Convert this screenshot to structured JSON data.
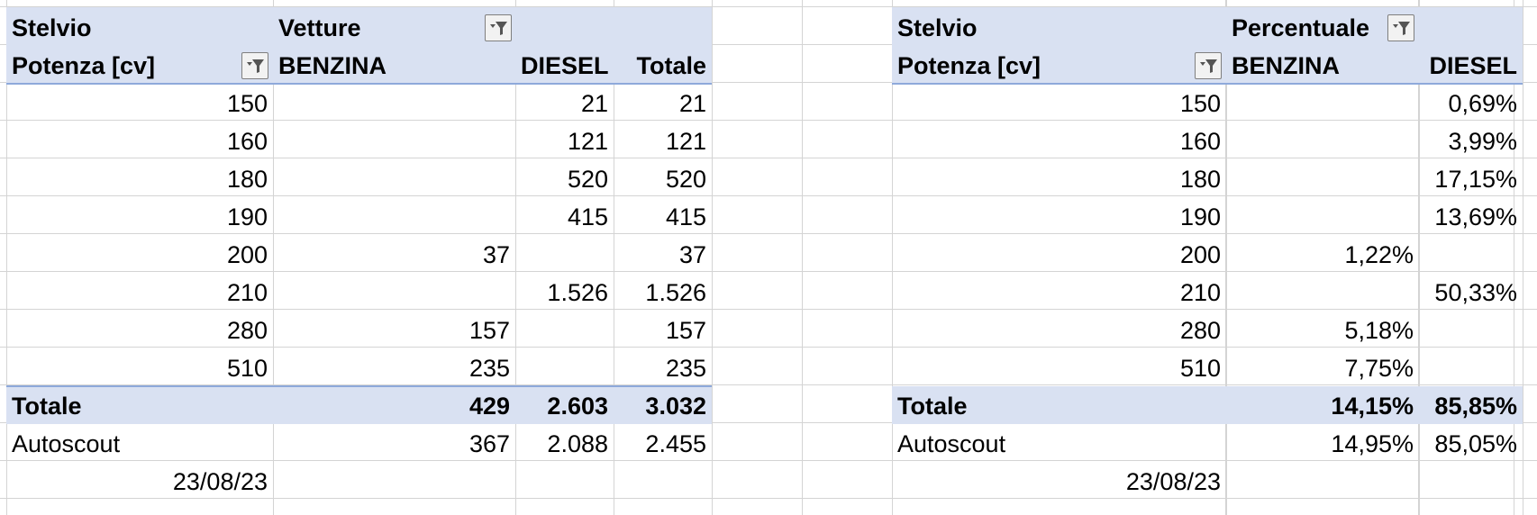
{
  "left_pivot": {
    "title": "Stelvio",
    "values_header": "Vetture",
    "row_header": "Potenza [cv]",
    "columns": [
      "BENZINA",
      "DIESEL",
      "Totale"
    ],
    "rows": [
      {
        "label": "150",
        "benzina": "",
        "diesel": "21",
        "totale": "21"
      },
      {
        "label": "160",
        "benzina": "",
        "diesel": "121",
        "totale": "121"
      },
      {
        "label": "180",
        "benzina": "",
        "diesel": "520",
        "totale": "520"
      },
      {
        "label": "190",
        "benzina": "",
        "diesel": "415",
        "totale": "415"
      },
      {
        "label": "200",
        "benzina": "37",
        "diesel": "",
        "totale": "37"
      },
      {
        "label": "210",
        "benzina": "",
        "diesel": "1.526",
        "totale": "1.526"
      },
      {
        "label": "280",
        "benzina": "157",
        "diesel": "",
        "totale": "157"
      },
      {
        "label": "510",
        "benzina": "235",
        "diesel": "",
        "totale": "235"
      }
    ],
    "total": {
      "label": "Totale",
      "benzina": "429",
      "diesel": "2.603",
      "totale": "3.032"
    },
    "extra": {
      "label": "Autoscout",
      "benzina": "367",
      "diesel": "2.088",
      "totale": "2.455"
    },
    "date": "23/08/23"
  },
  "right_pivot": {
    "title": "Stelvio",
    "values_header": "Percentuale",
    "row_header": "Potenza [cv]",
    "columns": [
      "BENZINA",
      "DIESEL"
    ],
    "rows": [
      {
        "label": "150",
        "benzina": "",
        "diesel": "0,69%"
      },
      {
        "label": "160",
        "benzina": "",
        "diesel": "3,99%"
      },
      {
        "label": "180",
        "benzina": "",
        "diesel": "17,15%"
      },
      {
        "label": "190",
        "benzina": "",
        "diesel": "13,69%"
      },
      {
        "label": "200",
        "benzina": "1,22%",
        "diesel": ""
      },
      {
        "label": "210",
        "benzina": "",
        "diesel": "50,33%"
      },
      {
        "label": "280",
        "benzina": "5,18%",
        "diesel": ""
      },
      {
        "label": "510",
        "benzina": "7,75%",
        "diesel": ""
      }
    ],
    "total": {
      "label": "Totale",
      "benzina": "14,15%",
      "diesel": "85,85%"
    },
    "extra": {
      "label": "Autoscout",
      "benzina": "14,95%",
      "diesel": "85,05%"
    },
    "date": "23/08/23"
  },
  "colors": {
    "header_band": "#d9e1f2",
    "band_border": "#8ea9db",
    "gridline": "#d4d4d4"
  },
  "icons": {
    "filter": "filter-dropdown-icon"
  }
}
